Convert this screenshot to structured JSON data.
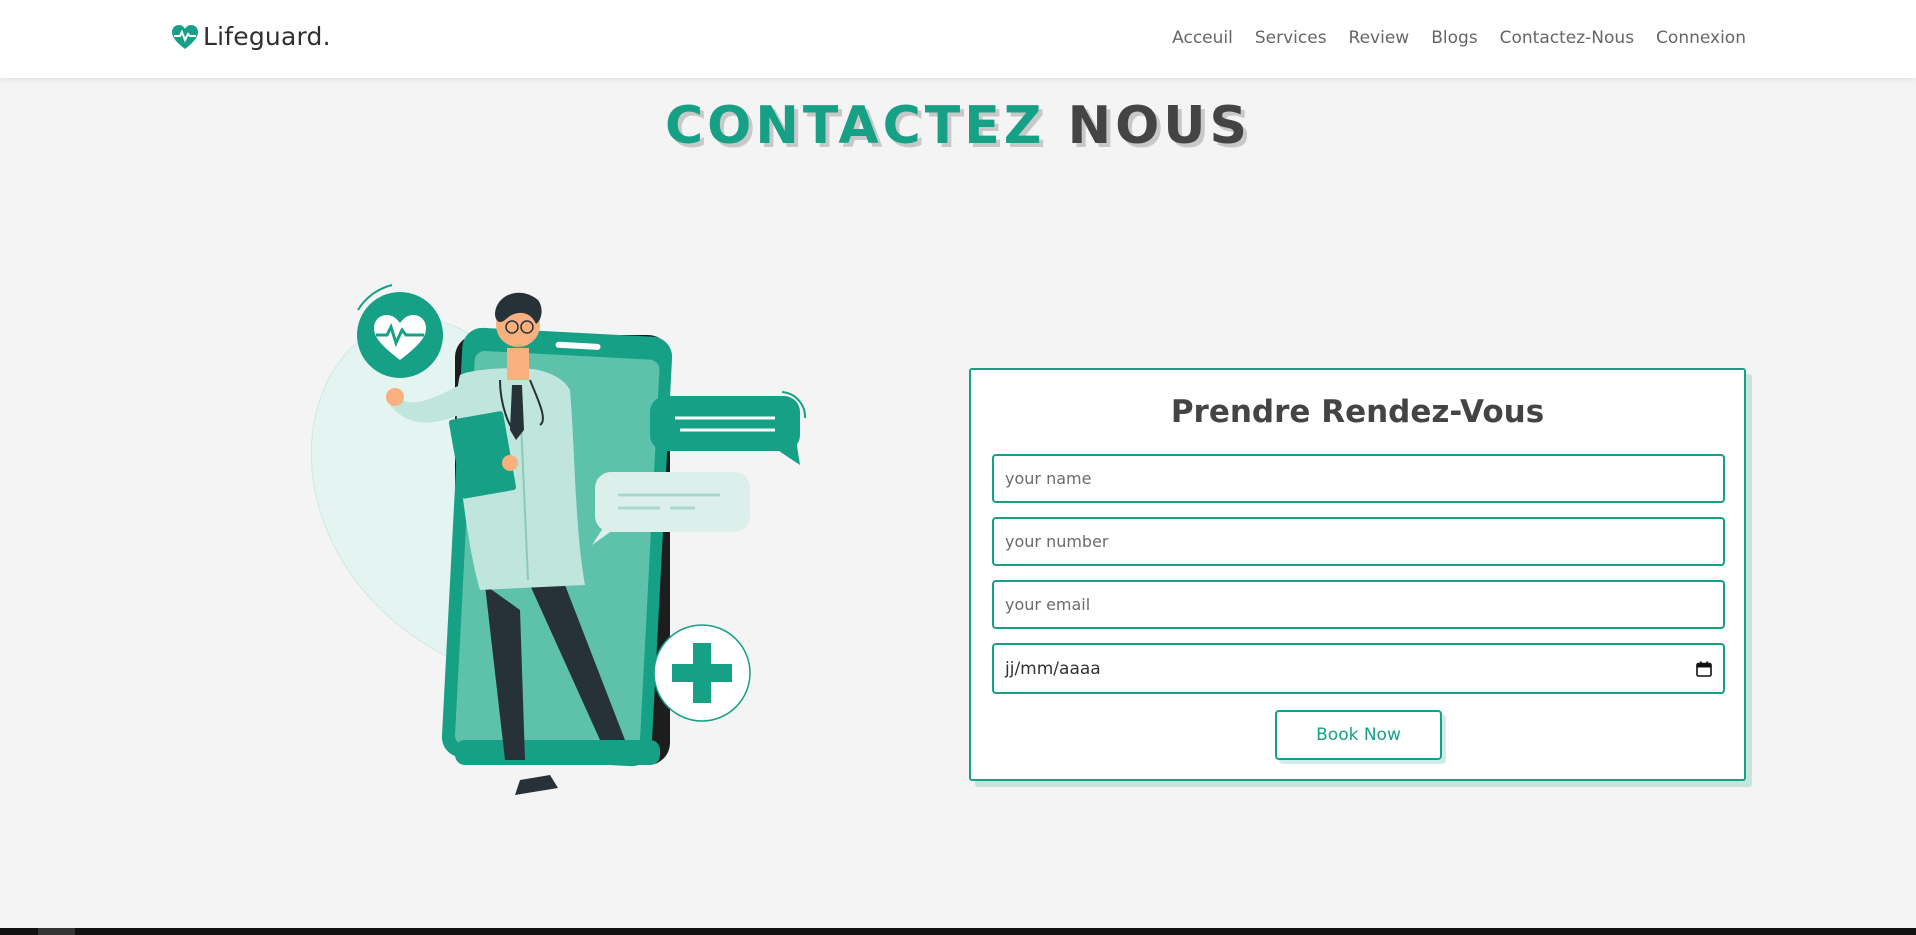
{
  "brand": {
    "name": "Lifeguard.",
    "icon": "heart-pulse-icon"
  },
  "nav": {
    "items": [
      "Acceuil",
      "Services",
      "Review",
      "Blogs",
      "Contactez-Nous",
      "Connexion"
    ]
  },
  "heading": {
    "part1": "CONTACTEZ",
    "part2": "NOUS"
  },
  "form": {
    "title": "Prendre Rendez-Vous",
    "name_placeholder": "your name",
    "number_placeholder": "your number",
    "email_placeholder": "your email",
    "date_value": "jj/mm/aaaa",
    "button_label": "Book Now"
  },
  "colors": {
    "accent": "#16a085",
    "dark_text": "#444444",
    "background": "#f4f4f4"
  }
}
